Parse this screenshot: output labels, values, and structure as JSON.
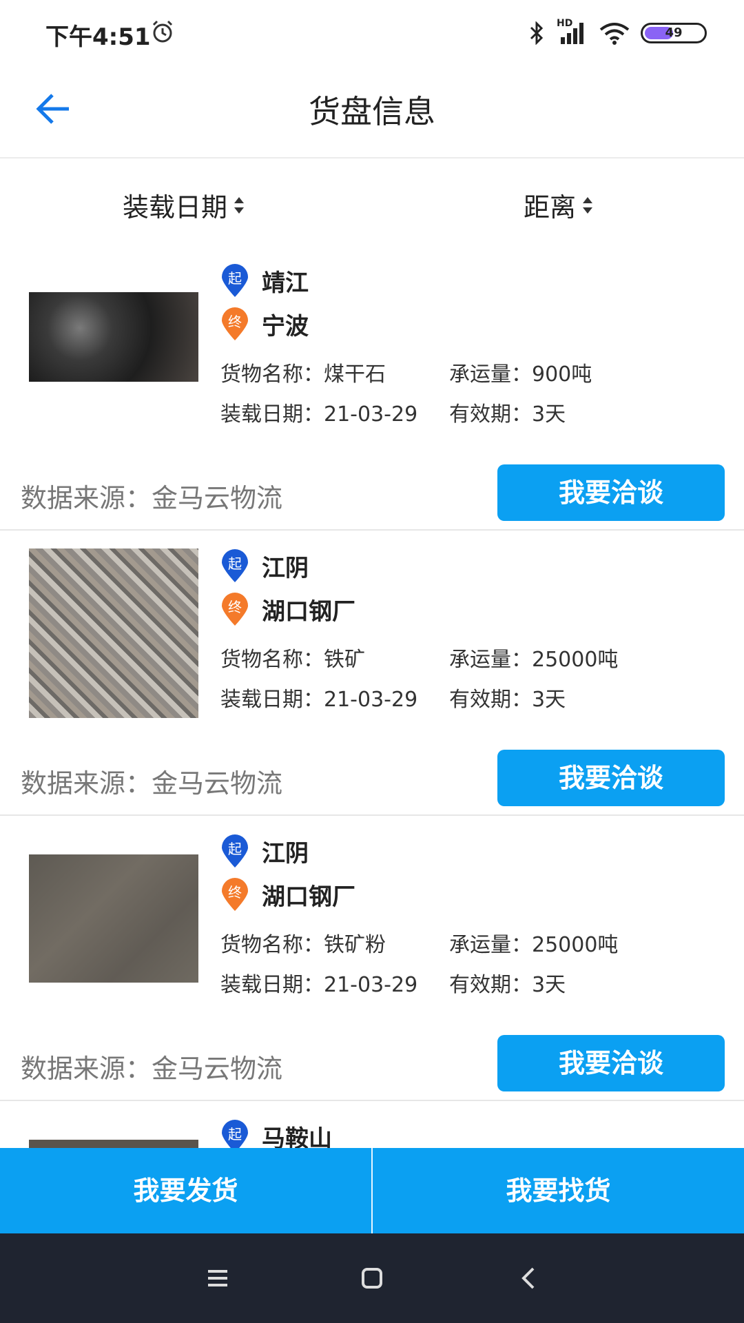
{
  "status_bar": {
    "time": "下午4:51",
    "network": "HD",
    "battery": "49",
    "battery_level": 0.49
  },
  "header": {
    "title": "货盘信息"
  },
  "sort": {
    "by_date": "装载日期",
    "by_distance": "距离"
  },
  "labels": {
    "start_badge": "起",
    "end_badge": "终"
  },
  "cards": [
    {
      "start": "靖江",
      "end": "宁波",
      "goods": "货物名称：煤干石",
      "capacity": "承运量：900吨",
      "date": "装载日期：21-03-29",
      "validity": "有效期：3天",
      "source": "数据来源：金马云物流",
      "button": "我要洽谈"
    },
    {
      "start": "江阴",
      "end": "湖口钢厂",
      "goods": "货物名称：铁矿",
      "capacity": "承运量：25000吨",
      "date": "装载日期：21-03-29",
      "validity": "有效期：3天",
      "source": "数据来源：金马云物流",
      "button": "我要洽谈"
    },
    {
      "start": "江阴",
      "end": "湖口钢厂",
      "goods": "货物名称：铁矿粉",
      "capacity": "承运量：25000吨",
      "date": "装载日期：21-03-29",
      "validity": "有效期：3天",
      "source": "数据来源：金马云物流",
      "button": "我要洽谈"
    },
    {
      "start": "马鞍山"
    }
  ],
  "bottom": {
    "ship_goods": "我要发货",
    "find_goods": "我要找货"
  },
  "colors": {
    "accent": "#0ba0f2",
    "start_pin": "#1a5ad6",
    "end_pin": "#f47a2a",
    "nav_bg": "#1f2430"
  },
  "icons": [
    "alarm-icon",
    "bluetooth-icon",
    "signal-icon",
    "wifi-icon",
    "battery-icon",
    "back-arrow-icon",
    "sort-arrows-icon",
    "start-pin-icon",
    "end-pin-icon",
    "menu-icon",
    "home-icon",
    "back-icon"
  ]
}
